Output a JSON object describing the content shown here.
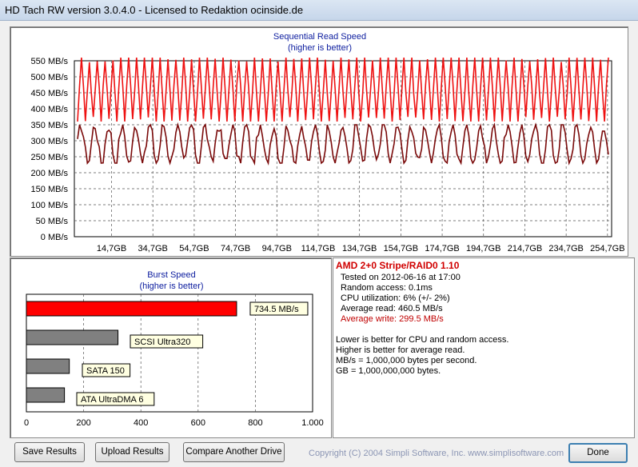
{
  "window": {
    "title": "HD Tach RW version 3.0.4.0 - Licensed to Redaktion ocinside.de"
  },
  "read_chart": {
    "title": "Sequential Read Speed",
    "subtitle": "(higher is better)"
  },
  "burst_chart": {
    "title": "Burst Speed",
    "subtitle": "(higher is better)"
  },
  "info": {
    "drive_name": "AMD 2+0 Stripe/RAID0 1.10",
    "tested_on": "Tested on 2012-06-16 at 17:00",
    "random_access": "Random access: 0.1ms",
    "cpu_utilization": "CPU utilization: 6% (+/- 2%)",
    "average_read": "Average read: 460.5 MB/s",
    "average_write": "Average write: 299.5 MB/s",
    "notes": [
      "Lower is better for CPU and random access.",
      "Higher is better for average read.",
      "MB/s = 1,000,000 bytes per second.",
      "GB = 1,000,000,000 bytes."
    ]
  },
  "buttons": {
    "save": "Save Results",
    "upload": "Upload Results",
    "compare": "Compare Another Drive",
    "done": "Done"
  },
  "copyright": "Copyright (C) 2004 Simpli Software, Inc. www.simplisoftware.com",
  "colors": {
    "read": "#ee1111",
    "write": "#7a0a0a",
    "bar_main": "#ff0000",
    "bar_ref": "#808080",
    "label_bg": "#ffffe1"
  },
  "chart_data": [
    {
      "type": "line",
      "title": "Sequential Read Speed",
      "subtitle": "(higher is better)",
      "ylim": [
        0,
        550
      ],
      "y_ticks": [
        "0 MB/s",
        "50 MB/s",
        "100 MB/s",
        "150 MB/s",
        "200 MB/s",
        "250 MB/s",
        "300 MB/s",
        "350 MB/s",
        "400 MB/s",
        "450 MB/s",
        "500 MB/s",
        "550 MB/s"
      ],
      "x_ticks": [
        "14,7GB",
        "34,7GB",
        "54,7GB",
        "74,7GB",
        "94,7GB",
        "114,7GB",
        "134,7GB",
        "154,7GB",
        "174,7GB",
        "194,7GB",
        "214,7GB",
        "234,7GB",
        "254,7GB"
      ],
      "series": [
        {
          "role": "read",
          "range": [
            360,
            560
          ]
        },
        {
          "role": "write",
          "range": [
            230,
            350
          ]
        }
      ]
    },
    {
      "type": "bar",
      "title": "Burst Speed",
      "subtitle": "(higher is better)",
      "xlim": [
        0,
        1000
      ],
      "x_ticks": [
        "0",
        "200",
        "400",
        "600",
        "800",
        "1.000"
      ],
      "bars": [
        {
          "label": "734.5 MB/s",
          "value": 734.5,
          "main": true
        },
        {
          "label": "SCSI Ultra320",
          "value": 320
        },
        {
          "label": "SATA 150",
          "value": 150
        },
        {
          "label": "ATA UltraDMA 6",
          "value": 133
        }
      ]
    }
  ]
}
